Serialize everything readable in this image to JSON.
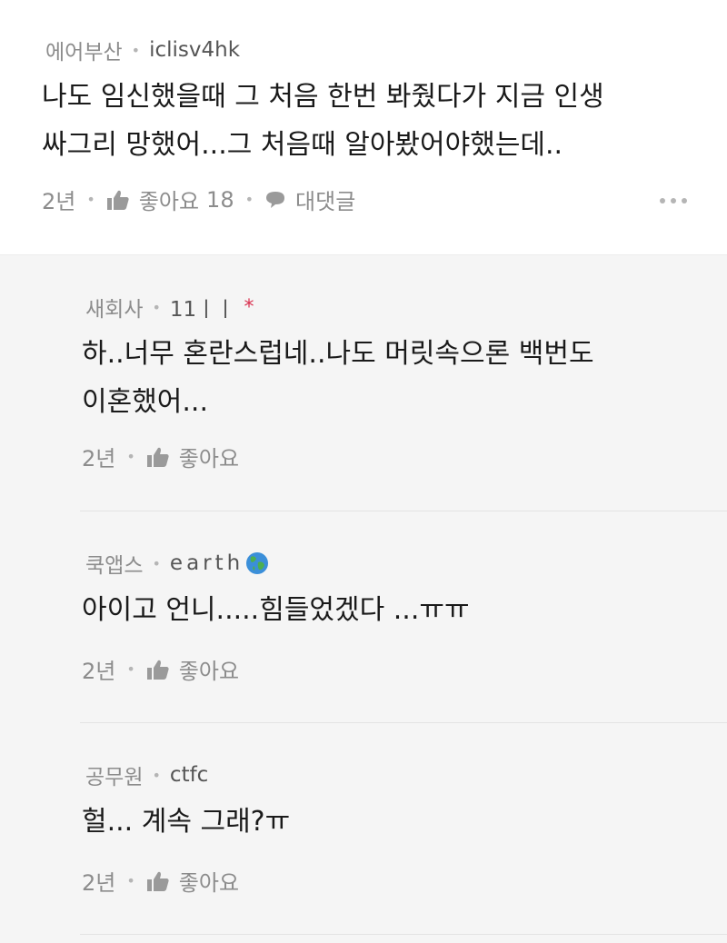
{
  "main_comment": {
    "community": "에어부산",
    "username": "iclisv4hk",
    "lines": [
      "나도 임신했을때 그 처음 한번 봐줬다가 지금 인생",
      "싸그리 망했어...그 처음때 알아봤어야했는데.."
    ],
    "time": "2년",
    "like_label": "좋아요",
    "like_count": "18",
    "reply_label": "대댓글",
    "icons": {
      "like": "thumbs-up-icon",
      "reply": "speech-bubble-icon",
      "more": "more-dots-icon"
    }
  },
  "replies": [
    {
      "community": "새회사",
      "username": "11ㅣㅣ",
      "badge": "*",
      "lines": [
        "하..너무 혼란스럽네..나도 머릿속으론 백번도",
        "이혼했어..."
      ],
      "time": "2년",
      "like_label": "좋아요"
    },
    {
      "community": "쿡앱스",
      "username": "earth",
      "emoji": "globe-icon",
      "lines": [
        "아이고 언니.....힘들었겠다 ...ㅠㅠ"
      ],
      "time": "2년",
      "like_label": "좋아요"
    },
    {
      "community": "공무원",
      "username": "ctfc",
      "lines": [
        "헐... 계속 그래?ㅠ"
      ],
      "time": "2년",
      "like_label": "좋아요"
    }
  ],
  "colors": {
    "background": "#ffffff",
    "reply_background": "#f5f5f5",
    "meta_text": "#8c8c8c",
    "badge": "#d9304f"
  }
}
